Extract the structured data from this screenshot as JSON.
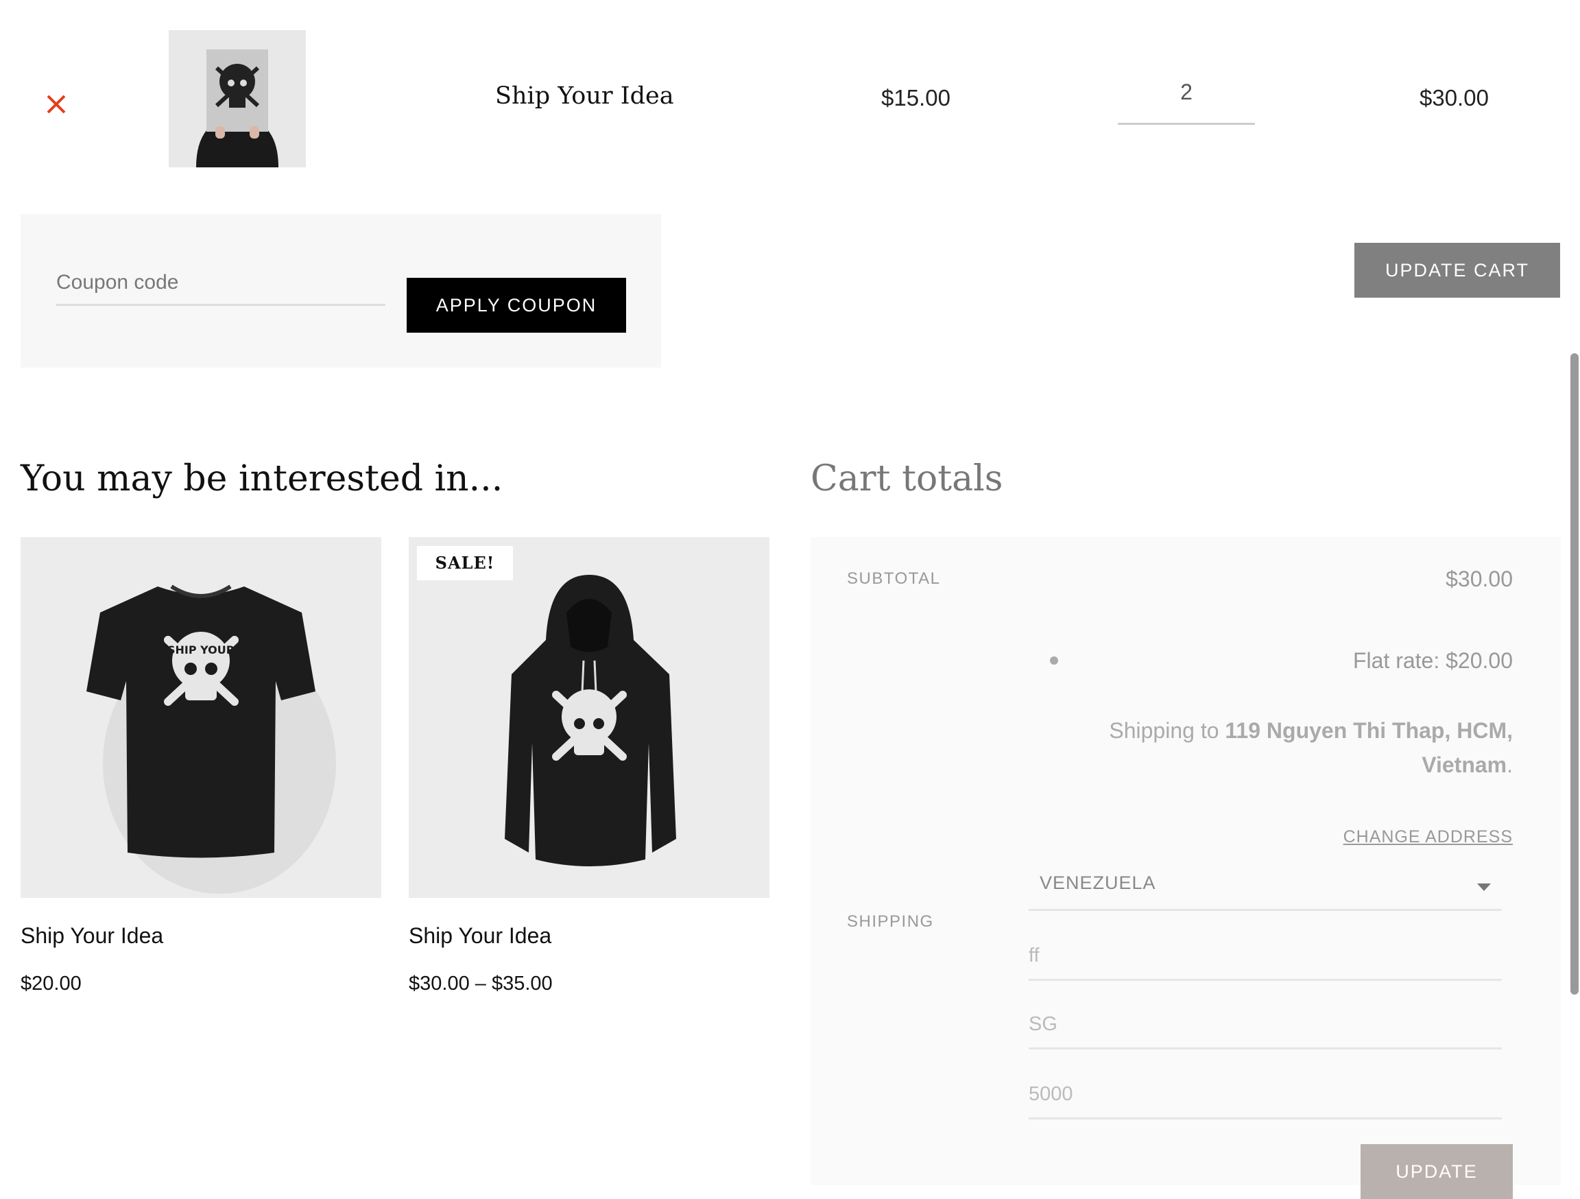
{
  "cart_row": {
    "product_name": "Ship Your Idea",
    "unit_price": "$15.00",
    "quantity": "2",
    "line_total": "$30.00"
  },
  "coupon": {
    "placeholder": "Coupon code",
    "apply_label": "APPLY COUPON"
  },
  "update_cart_label": "UPDATE CART",
  "interested": {
    "title": "You may be interested in...",
    "products": [
      {
        "name": "Ship Your Idea",
        "price": "$20.00",
        "badge": ""
      },
      {
        "name": "Ship Your Idea",
        "price": "$30.00 – $35.00",
        "badge": "SALE!"
      }
    ]
  },
  "totals": {
    "title": "Cart totals",
    "subtotal_label": "SUBTOTAL",
    "subtotal_value": "$30.00",
    "flat_rate": "Flat rate: $20.00",
    "shipping_to_prefix": "Shipping to ",
    "shipping_to_address": "119 Nguyen Thi Thap, HCM, Vietnam",
    "shipping_to_suffix": ".",
    "change_address": "CHANGE ADDRESS",
    "shipping_label": "SHIPPING",
    "country": "VENEZUELA",
    "state_value": "ff",
    "city_value": "SG",
    "zip_value": "5000",
    "update_label": "UPDATE"
  },
  "colors": {
    "remove": "#e2401c",
    "apply_button": "#000000",
    "update_cart_button": "#808080",
    "update_button": "#b9b1ae"
  },
  "icons": {
    "remove": "close-icon",
    "country_select": "chevron-down-icon"
  }
}
